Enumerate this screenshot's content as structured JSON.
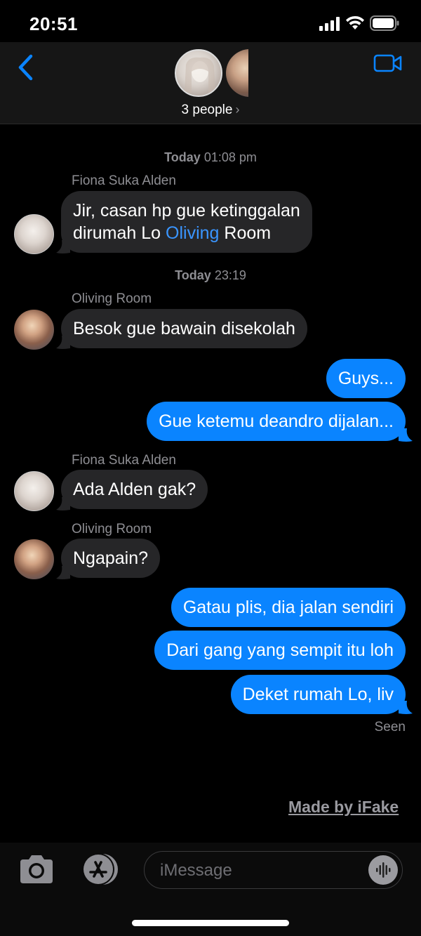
{
  "status_bar": {
    "time": "20:51"
  },
  "header": {
    "people_label": "3 people",
    "people_chevron": "›",
    "icons": [
      "chevron-left-icon",
      "video-camera-icon"
    ]
  },
  "colors": {
    "accent": "#0a84ff",
    "incoming_bubble": "#262628",
    "background": "#000000",
    "secondary_text": "#8e8e93"
  },
  "chat": {
    "timestamp_1": {
      "day": "Today",
      "time": "01:08 pm"
    },
    "msg1": {
      "sender": "Fiona Suka Alden",
      "line1": "Jir, casan hp gue ketinggalan",
      "line2_before": "dirumah Lo ",
      "line2_mention": "Oliving",
      "line2_after": " Room"
    },
    "timestamp_2": {
      "day": "Today",
      "time": "23:19"
    },
    "msg2": {
      "sender": "Oliving Room",
      "text": "Besok gue bawain disekolah"
    },
    "msg3": {
      "text": "Guys..."
    },
    "msg4": {
      "text": "Gue ketemu deandro dijalan..."
    },
    "msg5": {
      "sender": "Fiona Suka Alden",
      "text": "Ada Alden gak?"
    },
    "msg6": {
      "sender": "Oliving Room",
      "text": "Ngapain?"
    },
    "msg7": {
      "text": "Gatau plis, dia jalan sendiri"
    },
    "msg8": {
      "text": "Dari gang yang sempit itu loh"
    },
    "msg9": {
      "text": "Deket rumah Lo, liv"
    },
    "seen": "Seen"
  },
  "watermark": "Made by iFake",
  "input": {
    "placeholder": "iMessage"
  }
}
